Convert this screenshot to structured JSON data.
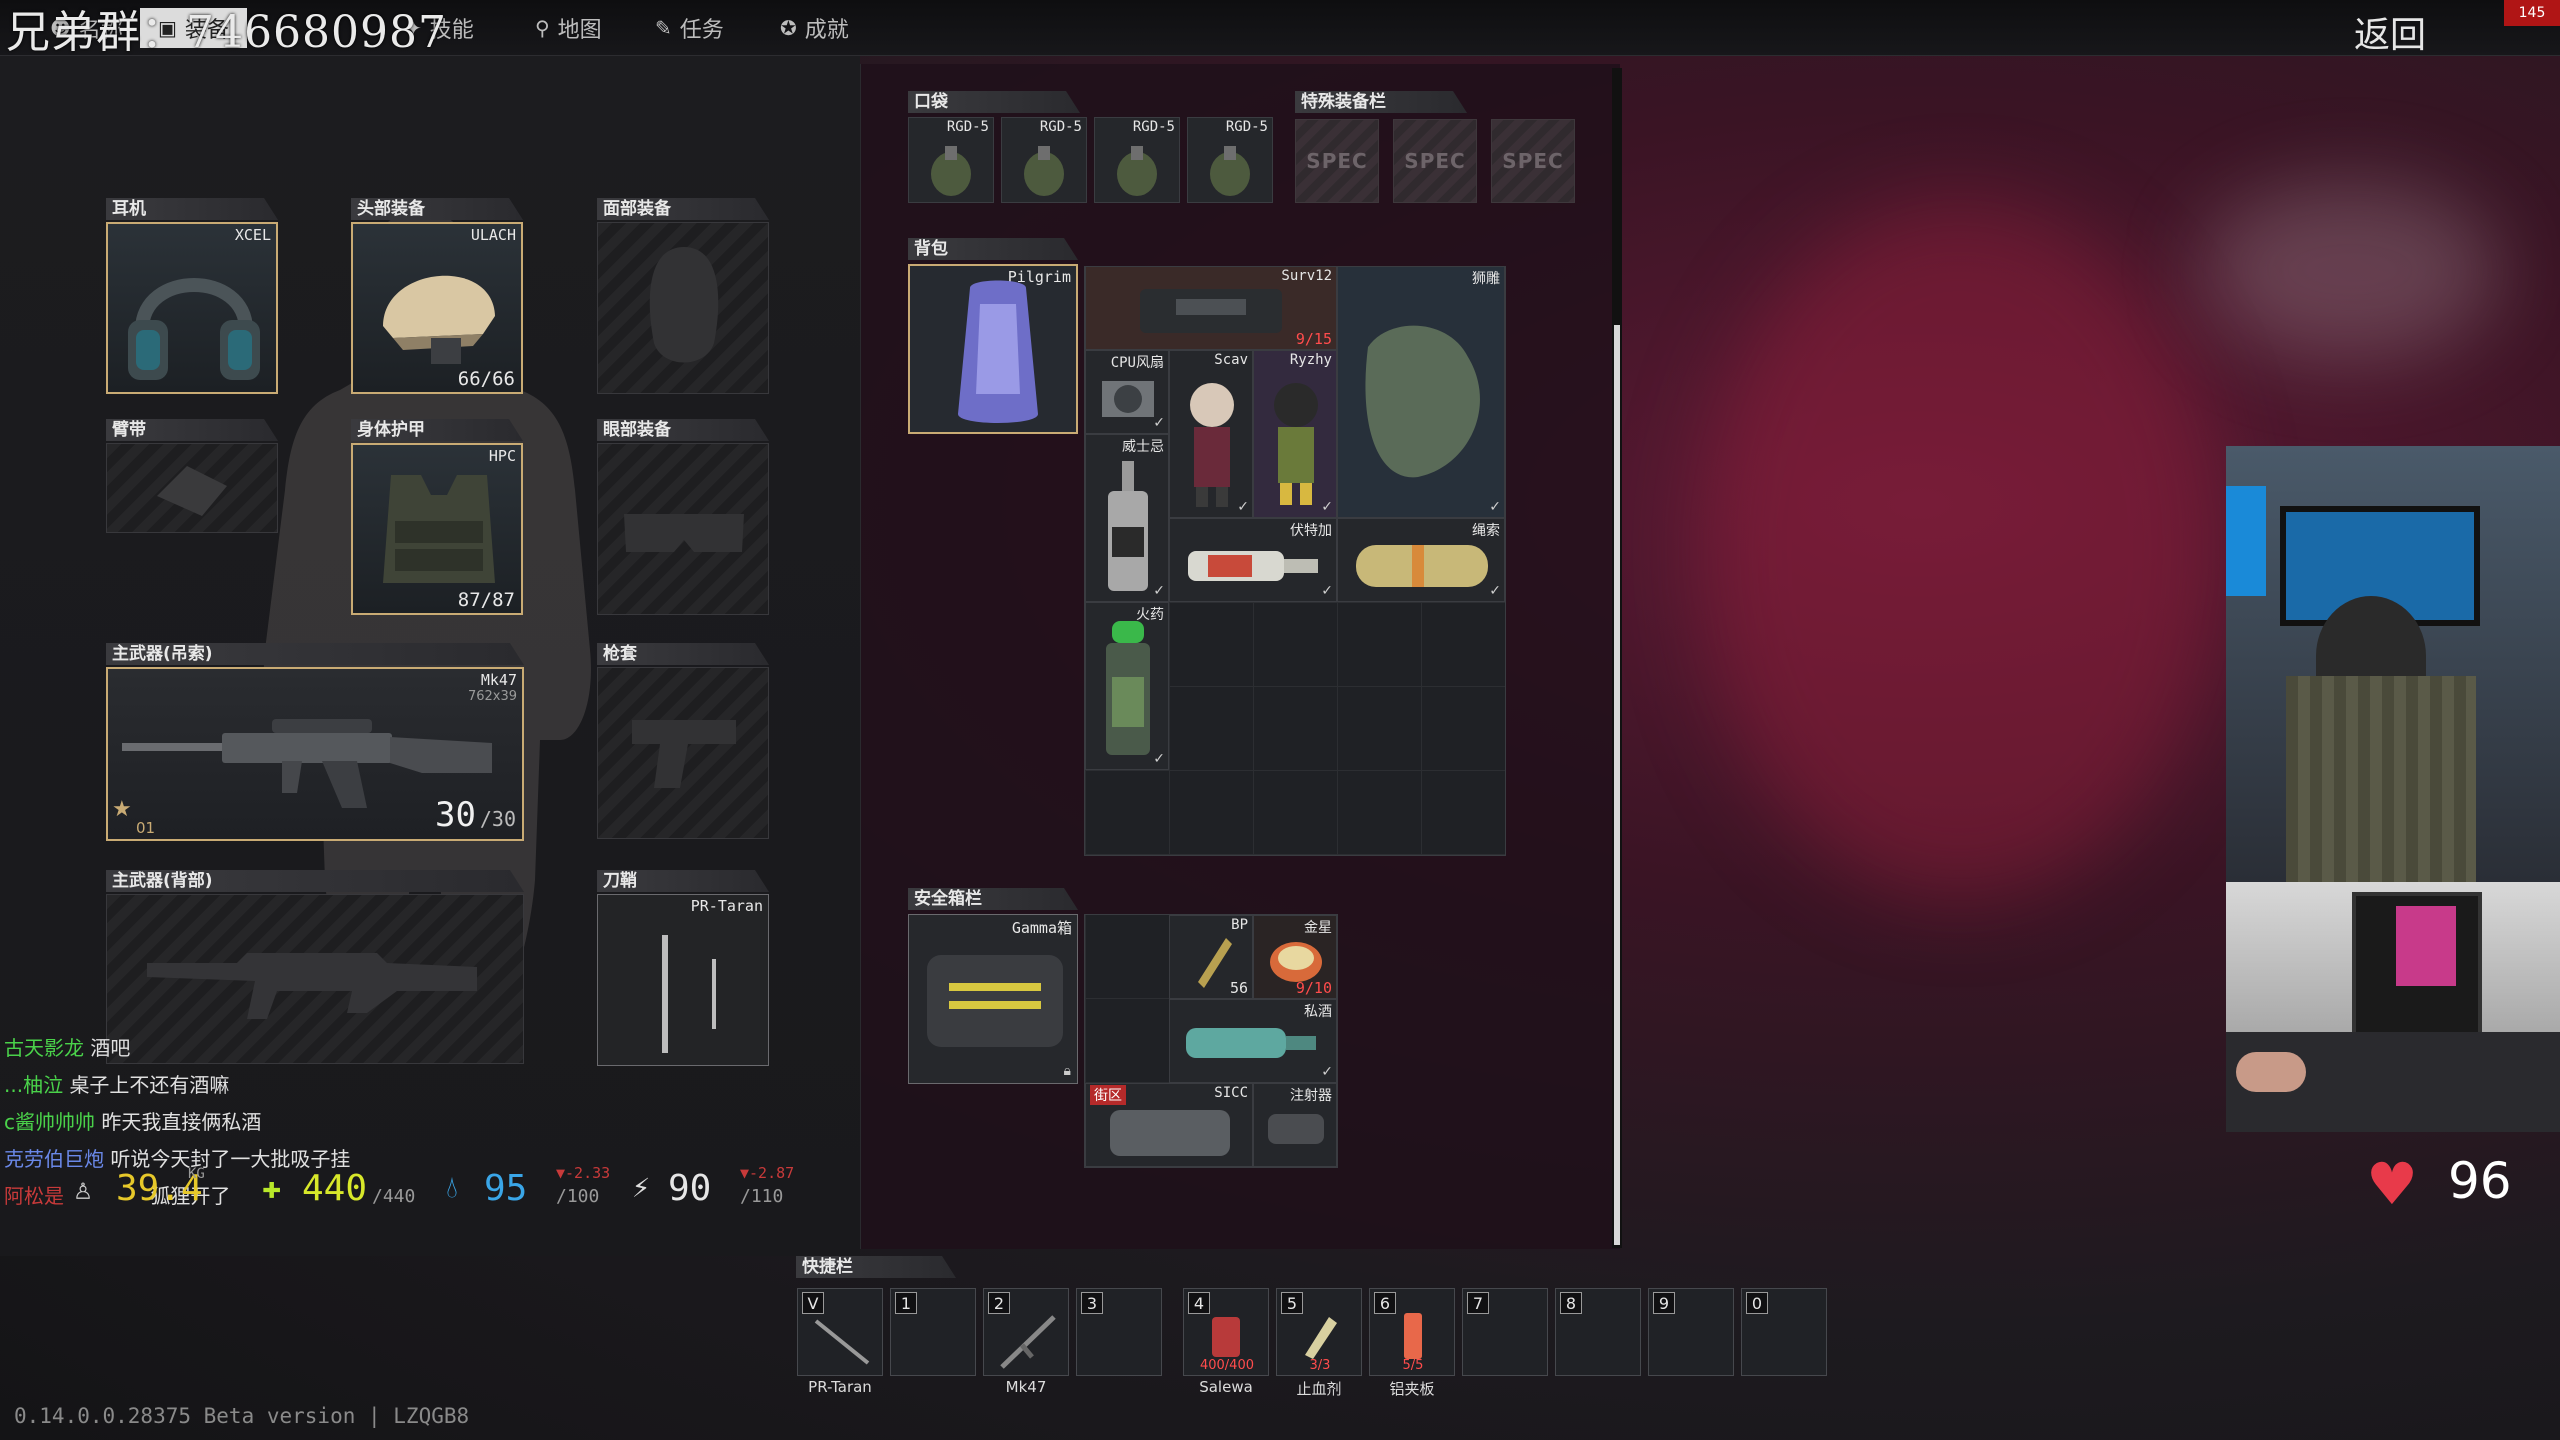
{
  "overlay_title": "兄弟群：746680987",
  "fps": "145",
  "back_label": "返回",
  "nav_tabs": [
    {
      "label": "名称",
      "icon": "user-icon"
    },
    {
      "label": "装备",
      "icon": "vest-icon"
    },
    {
      "label": "技能",
      "icon": "skills-icon"
    },
    {
      "label": "地图",
      "icon": "map-pin-icon"
    },
    {
      "label": "任务",
      "icon": "tasks-icon"
    },
    {
      "label": "成就",
      "icon": "achievement-icon"
    }
  ],
  "gear": {
    "earpiece": {
      "header": "耳机",
      "item": "XCEL"
    },
    "headwear": {
      "header": "头部装备",
      "item": "ULACH",
      "durability": "66/66"
    },
    "face_cover": {
      "header": "面部装备"
    },
    "armband": {
      "header": "臂带"
    },
    "body_armor": {
      "header": "身体护甲",
      "item": "HPC",
      "durability": "87/87"
    },
    "eyewear": {
      "header": "眼部装备"
    },
    "primary_sling": {
      "header": "主武器(吊索)",
      "item": "Mk47",
      "ammo_type": "762x39",
      "ammo": "30",
      "ammo_max": "/30",
      "mag_count": "01"
    },
    "holster": {
      "header": "枪套"
    },
    "primary_back": {
      "header": "主武器(背部)"
    },
    "scabbard": {
      "header": "刀鞘",
      "item": "PR-Taran"
    }
  },
  "pockets": {
    "header": "口袋",
    "items": [
      "RGD-5",
      "RGD-5",
      "RGD-5",
      "RGD-5"
    ]
  },
  "special": {
    "header": "特殊装备栏",
    "items": [
      "SPEC",
      "SPEC",
      "SPEC"
    ]
  },
  "backpack": {
    "header": "背包",
    "item": "Pilgrim",
    "contents": [
      {
        "label": "Surv12",
        "count": "9/15"
      },
      {
        "label": "狮雕"
      },
      {
        "label": "CPU风扇"
      },
      {
        "label": "Scav"
      },
      {
        "label": "Ryzhy"
      },
      {
        "label": "威士忌"
      },
      {
        "label": "伏特加"
      },
      {
        "label": "绳索"
      },
      {
        "label": "火药"
      }
    ]
  },
  "secure": {
    "header": "安全箱栏",
    "item": "Gamma箱",
    "contents": [
      {
        "label": "BP",
        "count": "56"
      },
      {
        "label": "金星",
        "count": "9/10"
      },
      {
        "label": "私酒"
      },
      {
        "label": "SICC",
        "tag": "街区"
      },
      {
        "label": "注射器"
      }
    ]
  },
  "chat": [
    {
      "user": "古天影龙",
      "msg": "酒吧"
    },
    {
      "user": "...柚泣",
      "msg": "桌子上不还有酒嘛"
    },
    {
      "user": "c酱帅帅帅",
      "msg": "昨天我直接俩私酒"
    },
    {
      "user": "克劳伯巨炮",
      "msg": "听说今天封了一大批吸子挂"
    },
    {
      "user": "阿松是",
      "msg": "狐狸开了"
    }
  ],
  "stats": {
    "weight": "39.4",
    "weight_unit": "KG",
    "health": "440",
    "health_max": "/440",
    "hydration": "95",
    "hydration_max": "/100",
    "hydration_rate": "▼-2.33",
    "energy": "90",
    "energy_max": "/110",
    "energy_rate": "▼-2.87"
  },
  "quickbar": {
    "header": "快捷栏",
    "slots": [
      {
        "key": "V",
        "label": "PR-Taran"
      },
      {
        "key": "1",
        "label": ""
      },
      {
        "key": "2",
        "label": "Mk47"
      },
      {
        "key": "3",
        "label": ""
      },
      {
        "key": "4",
        "label": "Salewa",
        "count": "400/400"
      },
      {
        "key": "5",
        "label": "止血剂",
        "count": "3/3"
      },
      {
        "key": "6",
        "label": "铝夹板",
        "count": "5/5"
      },
      {
        "key": "7",
        "label": ""
      },
      {
        "key": "8",
        "label": ""
      },
      {
        "key": "9",
        "label": ""
      },
      {
        "key": "0",
        "label": ""
      }
    ]
  },
  "heart_rate": "96",
  "version": "0.14.0.0.28375 Beta version | LZQGB8",
  "colors": {
    "accent_gold": "#c9ab74",
    "warn_red": "#ff4c4c",
    "health_yellow": "#e6e62a",
    "hydration_blue": "#3aa6e8",
    "chat_green": "#4ad24a"
  }
}
